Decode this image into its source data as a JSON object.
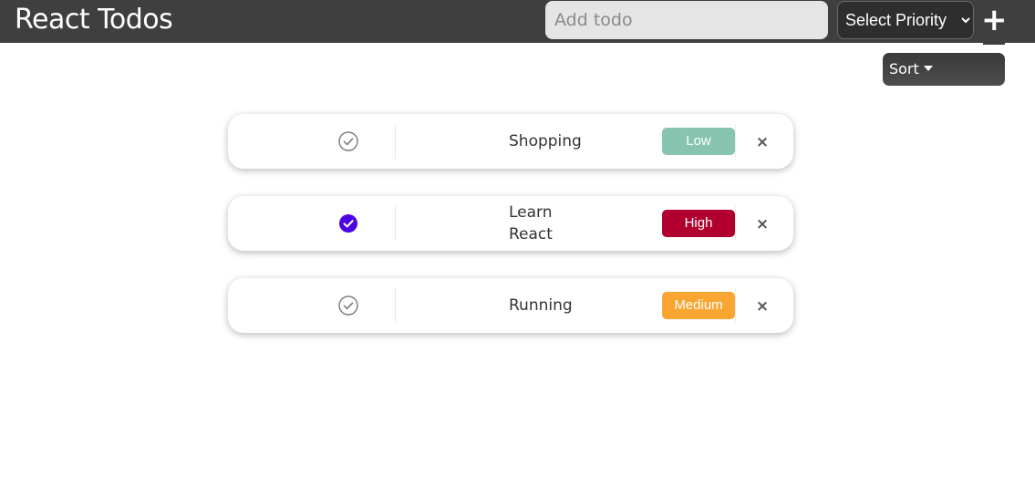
{
  "app": {
    "title": "React Todos"
  },
  "toolbar": {
    "add_placeholder": "Add todo",
    "priority_selected": "Select Priority",
    "add_button_label": "+",
    "sort_label": "Sort"
  },
  "todos": [
    {
      "text": "Shopping",
      "completed": false,
      "priority": "Low",
      "priority_color": "#88c5b1",
      "delete_label": "×"
    },
    {
      "text": "Learn React",
      "completed": true,
      "priority": "High",
      "priority_color": "#b10030",
      "delete_label": "×"
    },
    {
      "text": "Running",
      "completed": false,
      "priority": "Medium",
      "priority_color": "#f8a532",
      "delete_label": "×"
    }
  ],
  "colors": {
    "header_bg": "#3f3f3f",
    "check_done": "#4d04e4",
    "check_open": "#7a7a7a"
  },
  "icons": {
    "check": "check-circle-icon",
    "caret": "caret-down-icon",
    "delete": "close-icon"
  }
}
